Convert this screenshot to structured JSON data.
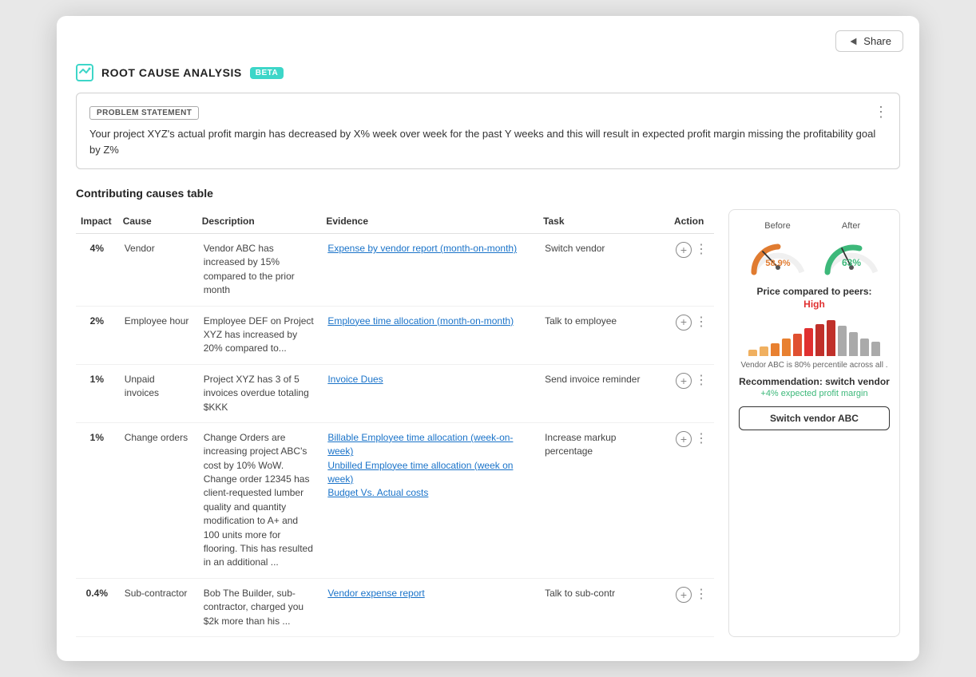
{
  "window": {
    "share_label": "Share"
  },
  "header": {
    "title": "ROOT CAUSE ANALYSIS",
    "beta": "BETA"
  },
  "problem": {
    "label": "PROBLEM STATEMENT",
    "text": "Your project XYZ's actual profit margin has decreased by X% week over week for the past Y weeks and this will result in expected profit margin missing the profitability goal by Z%"
  },
  "table_section": {
    "title": "Contributing causes table",
    "columns": [
      "Impact",
      "Cause",
      "Description",
      "Evidence",
      "Task",
      "Action"
    ],
    "rows": [
      {
        "impact": "4%",
        "cause": "Vendor",
        "description": "Vendor ABC has increased by 15% compared to the prior month",
        "evidence_links": [
          "Expense by vendor report (month-on-month)"
        ],
        "task": "Switch vendor",
        "action_type": "plus"
      },
      {
        "impact": "2%",
        "cause": "Employee hour",
        "description": "Employee DEF on Project XYZ has increased by 20% compared to...",
        "evidence_links": [
          "Employee time allocation (month-on-month)"
        ],
        "task": "Talk to employee",
        "action_type": "plus"
      },
      {
        "impact": "1%",
        "cause": "Unpaid invoices",
        "description": "Project XYZ has 3 of 5 invoices overdue totaling $KKK",
        "evidence_links": [
          "Invoice Dues"
        ],
        "task": "Send invoice reminder",
        "action_type": "plus"
      },
      {
        "impact": "1%",
        "cause": "Change orders",
        "description": "Change Orders are increasing project ABC's cost by 10% WoW. Change order 12345 has client-requested lumber quality and quantity modification to A+ and 100 units more for flooring. This has resulted in an additional ...",
        "evidence_links": [
          "Billable Employee time allocation (week-on-week)",
          "Unbilled Employee time allocation (week on week)",
          "Budget Vs. Actual costs"
        ],
        "task": "Increase markup percentage",
        "action_type": "plus"
      },
      {
        "impact": "0.4%",
        "cause": "Sub-contractor",
        "description": "Bob The Builder, sub-contractor, charged you $2k more than his ...",
        "evidence_links": [
          "Vendor expense report"
        ],
        "task": "Talk to sub-contr",
        "action_type": "plus"
      }
    ]
  },
  "right_panel": {
    "before_label": "Before",
    "after_label": "After",
    "before_value": "58.9%",
    "after_value": "63%",
    "peer_title": "Price compared to peers:",
    "peer_status": "High",
    "peer_note": "Vendor ABC is 80% percentile across all .",
    "rec_title": "Recommendation: switch vendor",
    "rec_profit": "+4% expected profit margin",
    "switch_btn": "Switch vendor ABC",
    "bars": [
      8,
      12,
      16,
      22,
      28,
      35,
      40,
      45,
      38,
      30,
      22,
      18
    ],
    "bar_colors": [
      "#f0b060",
      "#f0b060",
      "#e88030",
      "#e88030",
      "#e05030",
      "#e03030",
      "#c0302a",
      "#c0302a",
      "#aaaaaa",
      "#aaaaaa",
      "#aaaaaa",
      "#aaaaaa"
    ]
  }
}
